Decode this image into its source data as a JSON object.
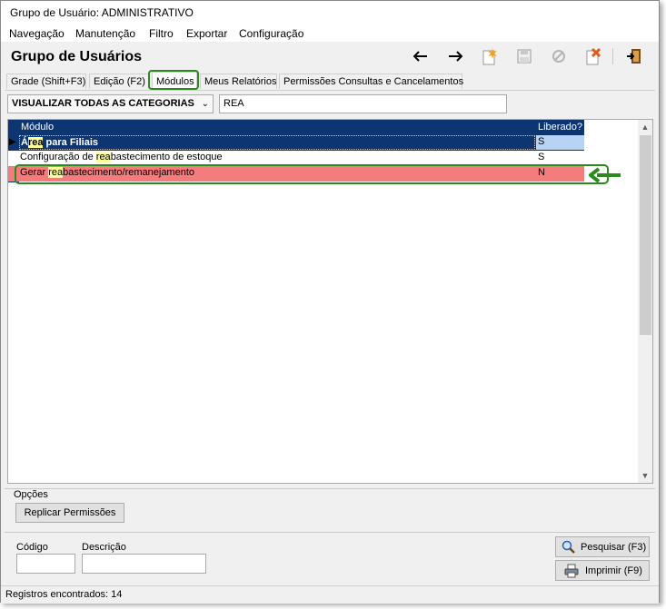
{
  "window": {
    "title": "Grupo de Usuário: ADMINISTRATIVO"
  },
  "menu": [
    "Navegação",
    "Manutenção",
    "Filtro",
    "Exportar",
    "Configuração"
  ],
  "header": {
    "title": "Grupo de Usuários"
  },
  "toolbar": {
    "icons": [
      "arrow-left-icon",
      "arrow-right-icon",
      "new-icon",
      "save-icon",
      "cancel-icon",
      "delete-icon",
      "exit-icon"
    ]
  },
  "tabs": [
    "Grade (Shift+F3)",
    "Edição (F2)",
    "Módulos",
    "Meus Relatórios",
    "Permissões Consultas e Cancelamentos"
  ],
  "filter": {
    "category": "VISUALIZAR TODAS AS CATEGORIAS",
    "search_value": "REA"
  },
  "grid": {
    "columns": [
      "Módulo",
      "Liberado?"
    ],
    "rows": [
      {
        "pre": "Á",
        "match": "rea",
        "post": " para Filiais",
        "liberado": "S"
      },
      {
        "pre": "Configuração de ",
        "match": "rea",
        "post": "bastecimento de estoque",
        "liberado": "S"
      },
      {
        "pre": "Gerar ",
        "match": "rea",
        "post": "bastecimento/remanejamento",
        "liberado": "N"
      }
    ]
  },
  "options": {
    "label": "Opções",
    "replicate_button": "Replicar Permissões"
  },
  "search_panel": {
    "code_label": "Código",
    "description_label": "Descrição",
    "search_button": "Pesquisar (F3)",
    "print_button": "Imprimir (F9)"
  },
  "status": {
    "records": "Registros encontrados: 14"
  },
  "colors": {
    "header_bg": "#0d3572",
    "selected_row": "#0d3572",
    "denied_row": "#f47c7c",
    "highlight": "#ffff99",
    "callout": "#2c8a1f"
  }
}
